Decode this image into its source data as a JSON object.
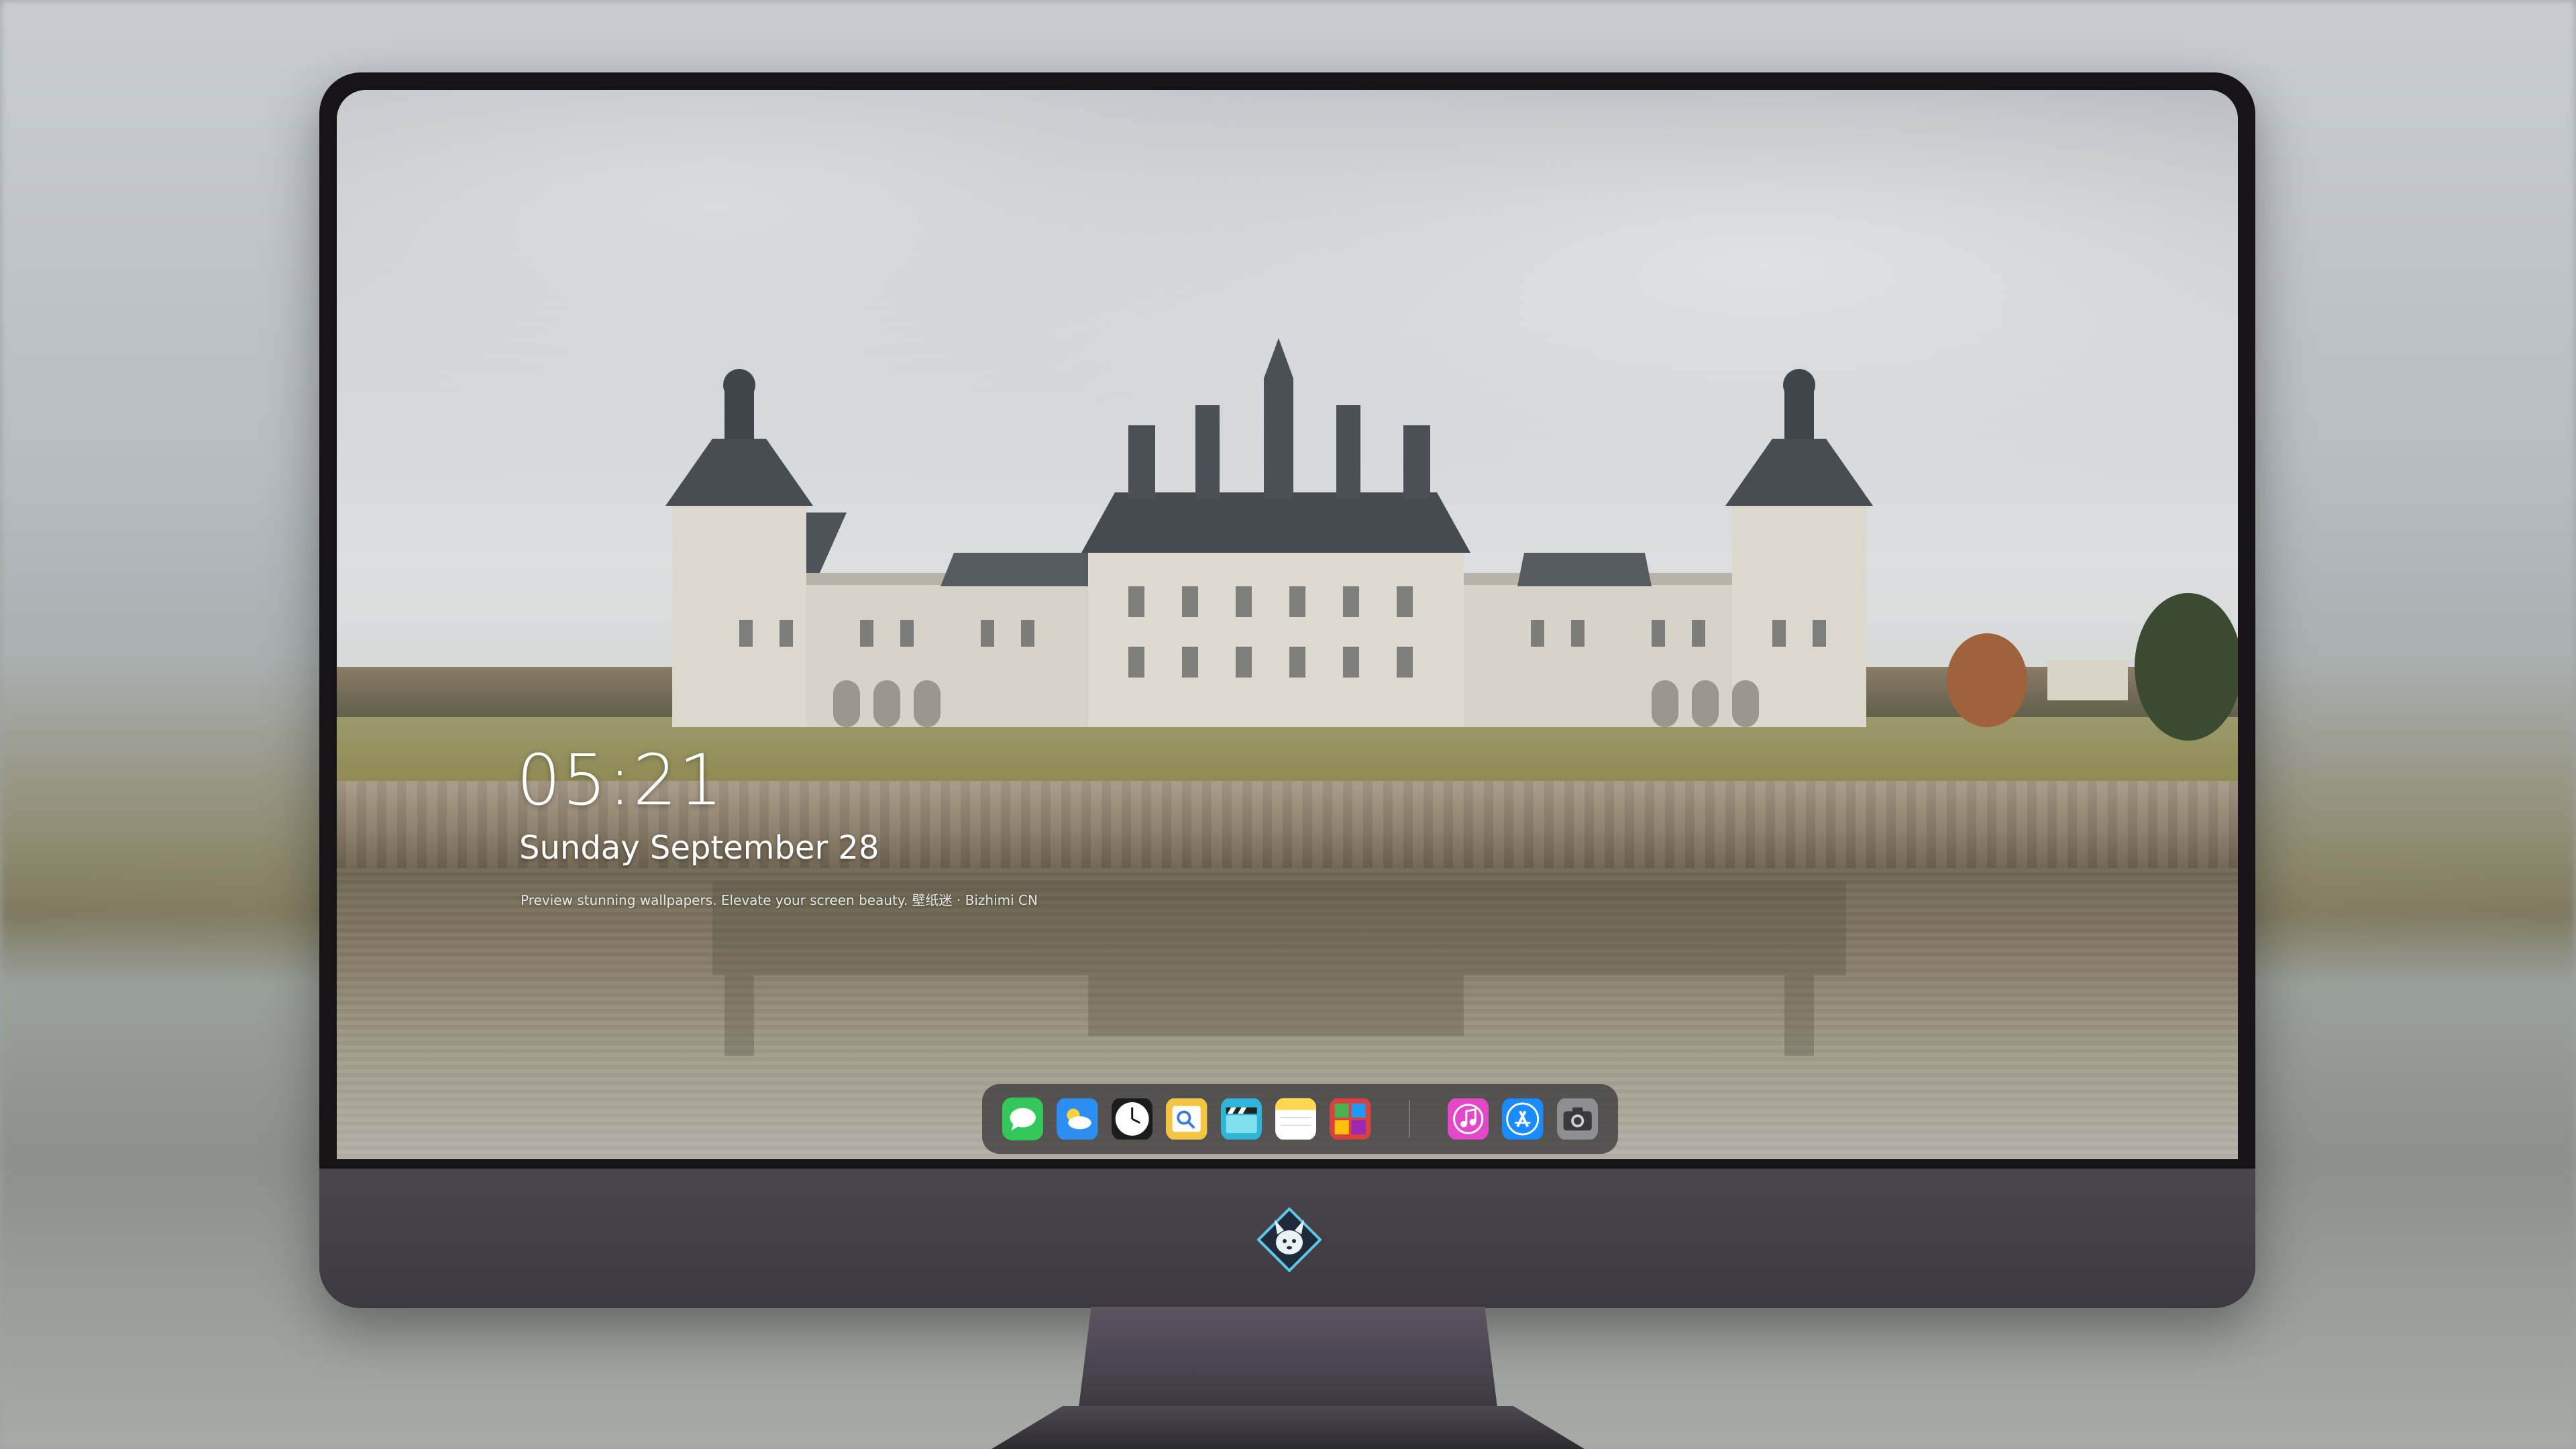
{
  "lock_screen": {
    "time": "05:21",
    "date": "Sunday September  28",
    "tagline": "Preview stunning wallpapers. Elevate your screen beauty. 壁纸迷 · Bizhimi CN"
  },
  "dock": {
    "apps": [
      {
        "name": "messages-icon",
        "color": "#34c759"
      },
      {
        "name": "weather-icon",
        "color": "#2b8ef0"
      },
      {
        "name": "clock-icon",
        "color": "#1c1c1e"
      },
      {
        "name": "preview-icon",
        "color": "#f4c542"
      },
      {
        "name": "clips-icon",
        "color": "#2fb5d8"
      },
      {
        "name": "notes-icon",
        "color": "#ffd84d"
      },
      {
        "name": "photo-booth-icon",
        "color": "#d94040"
      },
      {
        "name": "itunes-icon",
        "color": "#e249c8"
      },
      {
        "name": "app-store-icon",
        "color": "#1a8cff"
      },
      {
        "name": "camera-icon",
        "color": "#8e8e93"
      }
    ]
  },
  "monitor": {
    "logo": "fox-mascot-icon"
  },
  "colors": {
    "bezel": "#161417",
    "chin": "#443e47",
    "dock_bg": "rgba(60,58,62,0.78)"
  }
}
